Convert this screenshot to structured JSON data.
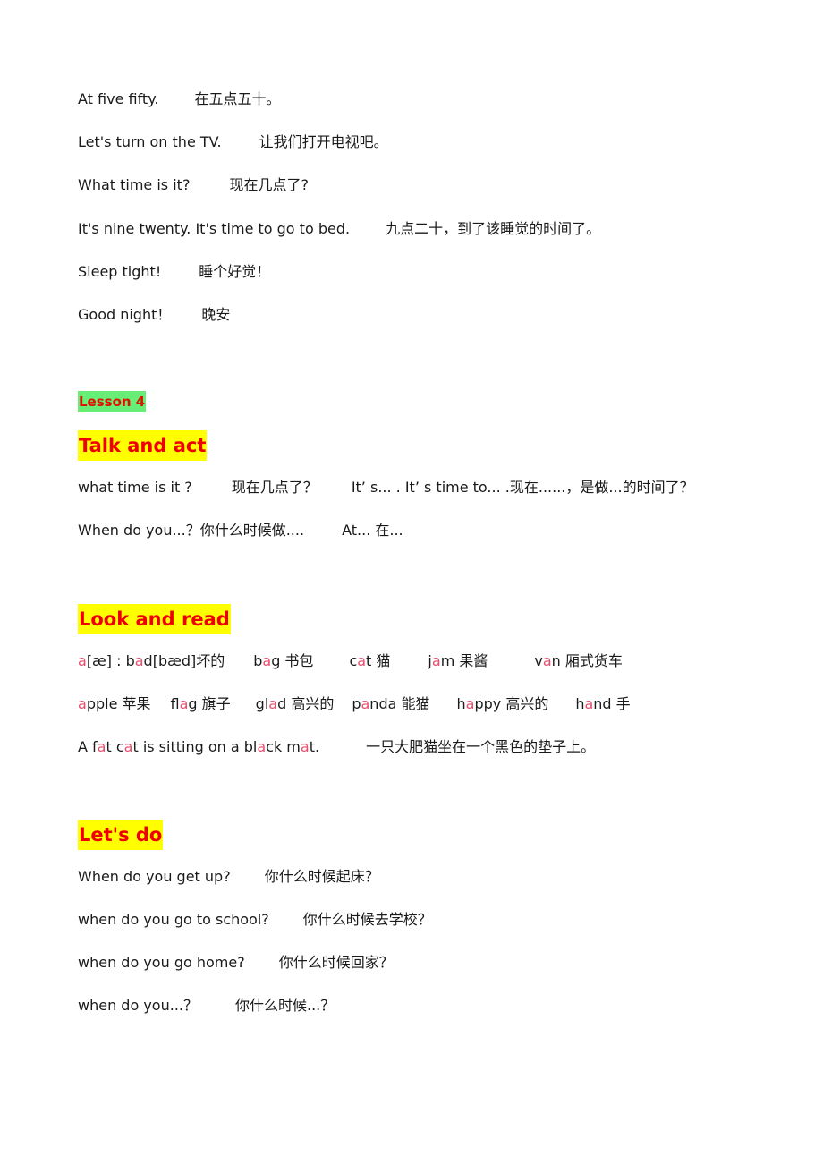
{
  "lines_top": [
    {
      "en": "At five fifty.",
      "zh": "在五点五十。"
    },
    {
      "en": "Let's turn on the TV.",
      "zh": "让我们打开电视吧。"
    },
    {
      "en": "What time is it?",
      "zh": "现在几点了?"
    },
    {
      "en": "It's nine twenty. It's time to go to bed.",
      "zh": "九点二十，到了该睡觉的时间了。"
    },
    {
      "en": "Sleep tight!",
      "zh": "睡个好觉！"
    },
    {
      "en": "Good night！",
      "zh": "晚安"
    }
  ],
  "lesson_label": "Lesson 4",
  "talk_and_act": {
    "heading": "Talk and act",
    "line1": {
      "en": "what time is it ?",
      "zh": "现在几点了？",
      "pattern": "It’ s... .  It’ s time to...  .现在......，是做...的时间了？"
    },
    "line2": {
      "en": "When do you...？你什么时候做....",
      "pattern": "At...  在..."
    }
  },
  "look_and_read": {
    "heading": "Look and read",
    "phonics_row1": [
      {
        "pre": "",
        "hl": "a",
        "post": " [æ] : b",
        "hl2": "a",
        "post2": "d[bæd]坏的"
      },
      {
        "pre": "b",
        "hl": "a",
        "post": "g 书包"
      },
      {
        "pre": "c",
        "hl": "a",
        "post": "t  猫"
      },
      {
        "pre": "j",
        "hl": "a",
        "post": "m  果酱"
      },
      {
        "pre": "v",
        "hl": "a",
        "post": "n  厢式货车"
      }
    ],
    "phonics_row2": [
      {
        "pre": "",
        "hl": "a",
        "post": "pple 苹果"
      },
      {
        "pre": "fl",
        "hl": "a",
        "post": "g 旗子"
      },
      {
        "pre": "gl",
        "hl": "a",
        "post": "d 高兴的"
      },
      {
        "pre": "p",
        "hl": "a",
        "post": "nda 能猫"
      },
      {
        "pre": "h",
        "hl": "a",
        "post": "ppy 高兴的"
      },
      {
        "pre": "h",
        "hl": "a",
        "post": "nd  手"
      }
    ],
    "sentence": {
      "parts": [
        "A f",
        "a",
        "t c",
        "a",
        "t is sitting on a bl",
        "a",
        "ck m",
        "a",
        "t."
      ],
      "zh": "一只大肥猫坐在一个黑色的垫子上。"
    }
  },
  "lets_do": {
    "heading": "Let's do",
    "lines": [
      {
        "en": "When do you get up?",
        "zh": "你什么时候起床？"
      },
      {
        "en": "when do you go to school?",
        "zh": "你什么时候去学校？"
      },
      {
        "en": "when do you go home?",
        "zh": "你什么时候回家？"
      },
      {
        "en": "when do you...？",
        "zh": "你什么时候...？"
      }
    ]
  },
  "colors": {
    "highlight_letter": "#e8506e",
    "heading_bg": "#ffff00",
    "heading_text": "#ee0000",
    "lesson_bg": "#66ee77"
  }
}
